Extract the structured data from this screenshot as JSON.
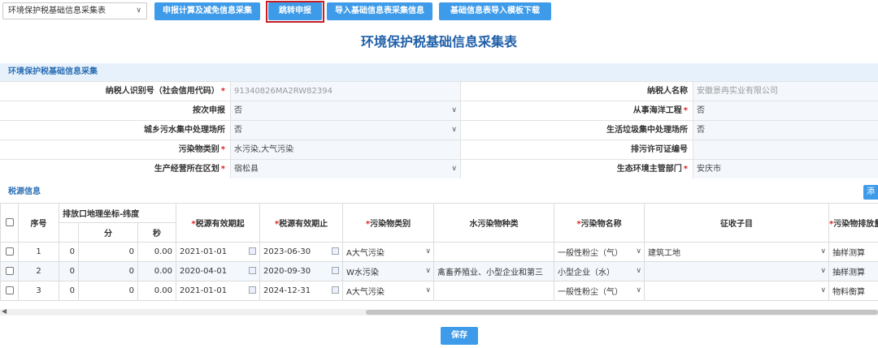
{
  "toolbar": {
    "select_value": "环境保护税基础信息采集表",
    "buttons": [
      "申报计算及减免信息采集",
      "跳转申报",
      "导入基础信息表采集信息",
      "基础信息表导入模板下载"
    ]
  },
  "page_title": "环境保护税基础信息采集表",
  "section_basic": "环境保护税基础信息采集",
  "form": {
    "taxpayer_id_label": "纳税人识别号（社会信用代码）",
    "taxpayer_id": "91340826MA2RW82394",
    "taxpayer_name_label": "纳税人名称",
    "taxpayer_name": "安徽景冉实业有限公司",
    "by_time_label": "按次申报",
    "by_time": "否",
    "marine_label": "从事海洋工程",
    "marine": "否",
    "sewage_label": "城乡污水集中处理场所",
    "sewage": "否",
    "garbage_label": "生活垃圾集中处理场所",
    "garbage": "否",
    "pollutant_type_label": "污染物类别",
    "pollutant_type": "水污染,大气污染",
    "permit_label": "排污许可证编号",
    "district_label": "生产经营所在区划",
    "district": "宿松县",
    "eco_label": "生态环境主管部门",
    "eco": "安庆市"
  },
  "section_source": "税源信息",
  "add_label": "添",
  "table": {
    "headers": {
      "index": "序号",
      "coord": "排放口地理坐标-纬度",
      "min": "分",
      "sec": "秒",
      "start": "税源有效期起",
      "end": "税源有效期止",
      "ptype": "污染物类别",
      "water": "水污染物种类",
      "pname": "污染物名称",
      "item": "征收子目",
      "method": "污染物排放量"
    },
    "rows": [
      {
        "idx": "1",
        "deg": "0",
        "min": "0",
        "sec": "0.00",
        "start": "2021-01-01",
        "end": "2023-06-30",
        "ptype": "A大气污染",
        "water": "",
        "pname": "一般性粉尘（气）",
        "item": "建筑工地",
        "method": "抽样测算"
      },
      {
        "idx": "2",
        "deg": "0",
        "min": "0",
        "sec": "0.00",
        "start": "2020-04-01",
        "end": "2020-09-30",
        "ptype": "W水污染",
        "water": "禽畜养殖业、小型企业和第三",
        "pname": "小型企业（水）",
        "item": "",
        "method": "抽样测算"
      },
      {
        "idx": "3",
        "deg": "0",
        "min": "0",
        "sec": "0.00",
        "start": "2021-01-01",
        "end": "2024-12-31",
        "ptype": "A大气污染",
        "water": "",
        "pname": "一般性粉尘（气）",
        "item": "",
        "method": "物料衡算"
      }
    ]
  },
  "save_label": "保存"
}
